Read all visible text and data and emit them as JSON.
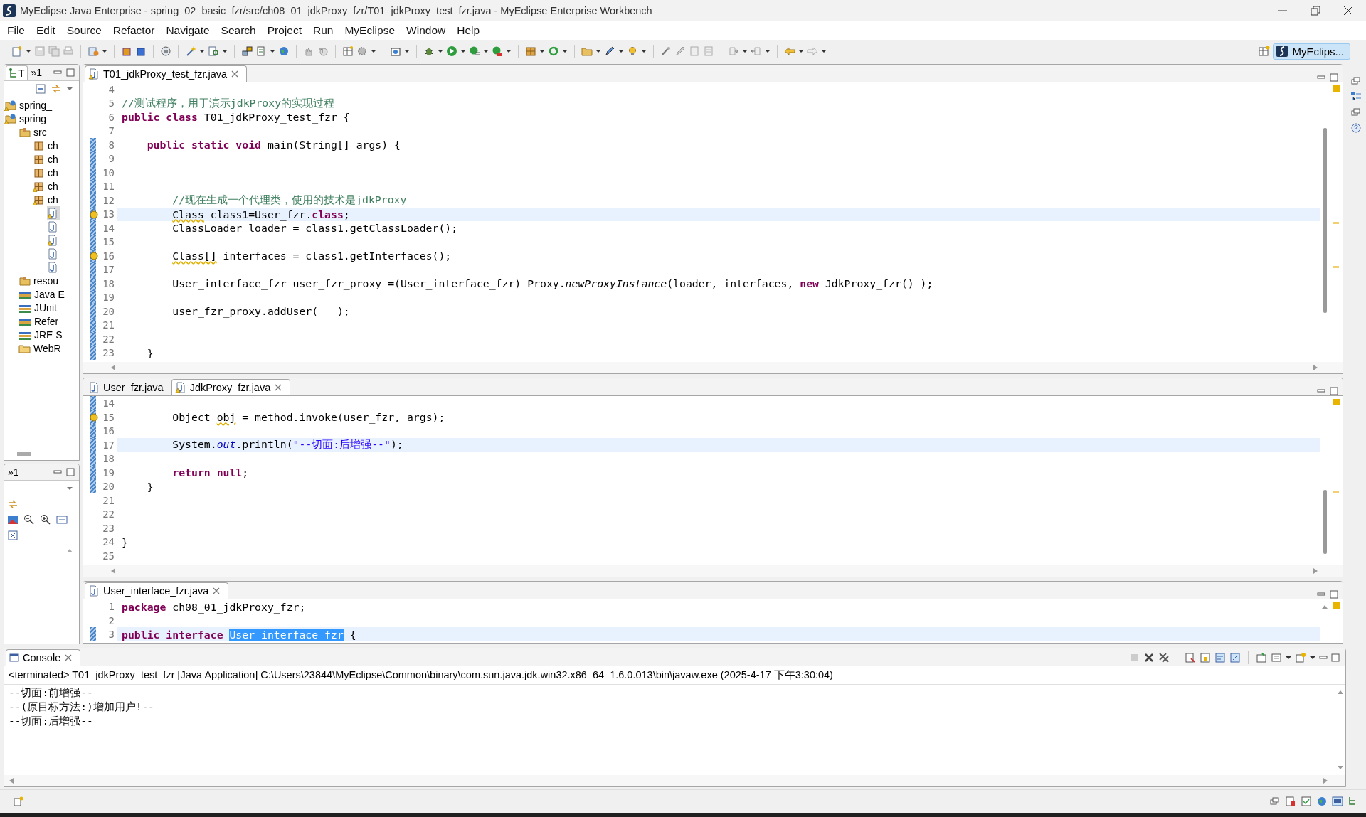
{
  "window": {
    "title": "MyEclipse Java Enterprise - spring_02_basic_fzr/src/ch08_01_jdkProxy_fzr/T01_jdkProxy_test_fzr.java - MyEclipse Enterprise Workbench"
  },
  "menu": [
    "File",
    "Edit",
    "Source",
    "Refactor",
    "Navigate",
    "Search",
    "Project",
    "Run",
    "MyEclipse",
    "Window",
    "Help"
  ],
  "perspective": {
    "label": "MyEclips..."
  },
  "left_panel": {
    "tabs": [
      {
        "label": "T",
        "selected": true
      },
      {
        "label": "»1",
        "selected": false
      }
    ],
    "tree": [
      {
        "kind": "project",
        "label": "spring_",
        "selected": false,
        "warning": true
      },
      {
        "kind": "project",
        "label": "spring_",
        "selected": false,
        "warning": true,
        "children": [
          {
            "kind": "source-folder",
            "label": "src",
            "selected": false,
            "warning": false,
            "children": [
              {
                "kind": "package",
                "label": "ch",
                "selected": false,
                "warning": false
              },
              {
                "kind": "package",
                "label": "ch",
                "selected": false,
                "warning": false
              },
              {
                "kind": "package",
                "label": "ch",
                "selected": false,
                "warning": false
              },
              {
                "kind": "package",
                "label": "ch",
                "selected": false,
                "warning": true
              },
              {
                "kind": "package",
                "label": "ch",
                "selected": false,
                "warning": true,
                "children": [
                  {
                    "kind": "file",
                    "selected": true,
                    "warning": true
                  },
                  {
                    "kind": "file",
                    "selected": false,
                    "warning": false
                  },
                  {
                    "kind": "file",
                    "selected": false,
                    "warning": true
                  },
                  {
                    "kind": "file",
                    "selected": false,
                    "warning": false
                  },
                  {
                    "kind": "file",
                    "selected": false,
                    "warning": false
                  }
                ]
              }
            ]
          },
          {
            "kind": "source-folder",
            "label": "resou",
            "selected": false,
            "warning": false
          },
          {
            "kind": "library",
            "label": "Java E",
            "selected": false,
            "warning": false
          },
          {
            "kind": "library",
            "label": "JUnit",
            "selected": false,
            "warning": false
          },
          {
            "kind": "library",
            "label": "Refer",
            "selected": false,
            "warning": false
          },
          {
            "kind": "library",
            "label": "JRE S",
            "selected": false,
            "warning": false
          },
          {
            "kind": "folder",
            "label": "WebR",
            "selected": false,
            "warning": false
          }
        ]
      }
    ]
  },
  "left_panel_2": {
    "tabs": [
      {
        "label": "»1",
        "selected": false
      }
    ]
  },
  "editors": [
    {
      "tabs": [
        {
          "label": "T01_jdkProxy_test_fzr.java",
          "selected": true,
          "warning": true
        }
      ],
      "lines": [
        {
          "number": "4",
          "changed": false,
          "current": false,
          "warning": false
        },
        {
          "number": "5",
          "changed": false,
          "current": false,
          "warning": false,
          "segments": [
            {
              "kind": "comment",
              "t": "//测试程序，用于演示jdkProxy的实现过程"
            }
          ]
        },
        {
          "number": "6",
          "changed": false,
          "current": false,
          "warning": false,
          "segments": [
            {
              "kind": "keyword",
              "t": "public class"
            },
            {
              "kind": "plain",
              "t": " T01_jdkProxy_test_fzr {"
            }
          ]
        },
        {
          "number": "7",
          "changed": false,
          "current": false,
          "warning": false
        },
        {
          "number": "8",
          "changed": true,
          "current": false,
          "warning": false,
          "segments": [
            {
              "kind": "keyword",
              "t": "    public static void"
            },
            {
              "kind": "plain",
              "t": " main(String[] args) {"
            }
          ]
        },
        {
          "number": "9",
          "changed": true,
          "current": false,
          "warning": false
        },
        {
          "number": "10",
          "changed": true,
          "current": false,
          "warning": false
        },
        {
          "number": "11",
          "changed": true,
          "current": false,
          "warning": false
        },
        {
          "number": "12",
          "changed": true,
          "current": false,
          "warning": false,
          "segments": [
            {
              "kind": "comment",
              "t": "        //现在生成一个代理类，使用的技术是jdkProxy"
            }
          ]
        },
        {
          "number": "13",
          "changed": true,
          "current": true,
          "warning": true,
          "segments": [
            {
              "kind": "warning",
              "t": "        Class"
            },
            {
              "kind": "plain",
              "t": " class1=User_fzr."
            },
            {
              "kind": "keyword",
              "t": "class"
            },
            {
              "kind": "plain",
              "t": ";"
            }
          ]
        },
        {
          "number": "14",
          "changed": true,
          "current": false,
          "warning": false,
          "segments": [
            {
              "kind": "plain",
              "t": "        ClassLoader loader = class1.getClassLoader();"
            }
          ]
        },
        {
          "number": "15",
          "changed": true,
          "current": false,
          "warning": false
        },
        {
          "number": "16",
          "changed": true,
          "current": false,
          "warning": true,
          "segments": [
            {
              "kind": "warning",
              "t": "        Class[]"
            },
            {
              "kind": "plain",
              "t": " interfaces = class1.getInterfaces();"
            }
          ]
        },
        {
          "number": "17",
          "changed": true,
          "current": false,
          "warning": false
        },
        {
          "number": "18",
          "changed": true,
          "current": false,
          "warning": false,
          "segments": [
            {
              "kind": "plain",
              "t": "        User_interface_fzr user_fzr_proxy =(User_interface_fzr) Proxy."
            },
            {
              "kind": "italic",
              "t": "newProxyInstance"
            },
            {
              "kind": "plain",
              "t": "(loader, interfaces, "
            },
            {
              "kind": "keyword",
              "t": "new"
            },
            {
              "kind": "plain",
              "t": " JdkProxy_fzr() );"
            }
          ]
        },
        {
          "number": "19",
          "changed": true,
          "current": false,
          "warning": false
        },
        {
          "number": "20",
          "changed": true,
          "current": false,
          "warning": false,
          "segments": [
            {
              "kind": "plain",
              "t": "        user_fzr_proxy.addUser(   );"
            }
          ]
        },
        {
          "number": "21",
          "changed": true,
          "current": false,
          "warning": false
        },
        {
          "number": "22",
          "changed": true,
          "current": false,
          "warning": false
        },
        {
          "number": "23",
          "changed": true,
          "current": false,
          "warning": false,
          "segments": [
            {
              "kind": "plain",
              "t": "    }"
            }
          ]
        }
      ]
    },
    {
      "tabs": [
        {
          "label": "User_fzr.java",
          "selected": false,
          "warning": false
        },
        {
          "label": "JdkProxy_fzr.java",
          "selected": true,
          "warning": true
        }
      ],
      "lines": [
        {
          "number": "14",
          "changed": true,
          "current": false,
          "warning": false
        },
        {
          "number": "15",
          "changed": true,
          "current": false,
          "warning": true,
          "segments": [
            {
              "kind": "plain",
              "t": "        Object "
            },
            {
              "kind": "warning",
              "t": "obj"
            },
            {
              "kind": "plain",
              "t": " = method.invoke(user_fzr, args);"
            }
          ]
        },
        {
          "number": "16",
          "changed": true,
          "current": false,
          "warning": false
        },
        {
          "number": "17",
          "changed": true,
          "current": true,
          "warning": false,
          "segments": [
            {
              "kind": "plain",
              "t": "        System."
            },
            {
              "kind": "field",
              "t": "out"
            },
            {
              "kind": "plain",
              "t": ".println("
            },
            {
              "kind": "string",
              "t": "\"--切面:后增强--\""
            },
            {
              "kind": "plain",
              "t": ");"
            }
          ]
        },
        {
          "number": "18",
          "changed": true,
          "current": false,
          "warning": false
        },
        {
          "number": "19",
          "changed": true,
          "current": false,
          "warning": false,
          "segments": [
            {
              "kind": "keyword",
              "t": "        return null"
            },
            {
              "kind": "plain",
              "t": ";"
            }
          ]
        },
        {
          "number": "20",
          "changed": true,
          "current": false,
          "warning": false,
          "segments": [
            {
              "kind": "plain",
              "t": "    }"
            }
          ]
        },
        {
          "number": "21",
          "changed": false,
          "current": false,
          "warning": false
        },
        {
          "number": "22",
          "changed": false,
          "current": false,
          "warning": false
        },
        {
          "number": "23",
          "changed": false,
          "current": false,
          "warning": false
        },
        {
          "number": "24",
          "changed": false,
          "current": false,
          "warning": false,
          "segments": [
            {
              "kind": "plain",
              "t": "}"
            }
          ]
        },
        {
          "number": "25",
          "changed": false,
          "current": false,
          "warning": false
        }
      ]
    },
    {
      "tabs": [
        {
          "label": "User_interface_fzr.java",
          "selected": true,
          "warning": false
        }
      ],
      "lines": [
        {
          "number": "1",
          "changed": false,
          "current": false,
          "warning": false,
          "segments": [
            {
              "kind": "keyword",
              "t": "package"
            },
            {
              "kind": "plain",
              "t": " ch08_01_jdkProxy_fzr;"
            }
          ]
        },
        {
          "number": "2",
          "changed": false,
          "current": false,
          "warning": false
        },
        {
          "number": "3",
          "changed": true,
          "current": true,
          "warning": false,
          "segments": [
            {
              "kind": "keyword",
              "t": "public interface "
            },
            {
              "kind": "selection",
              "t": "User_interface_fzr"
            },
            {
              "kind": "plain",
              "t": " {"
            }
          ]
        }
      ]
    }
  ],
  "console": {
    "title": "Console",
    "header": "<terminated> T01_jdkProxy_test_fzr [Java Application] C:\\Users\\23844\\MyEclipse\\Common\\binary\\com.sun.java.jdk.win32.x86_64_1.6.0.013\\bin\\javaw.exe (2025-4-17 下午3:30:04)",
    "output": [
      "--切面:前增强--",
      "--(原目标方法:)增加用户!--",
      "--切面:后增强--"
    ]
  }
}
